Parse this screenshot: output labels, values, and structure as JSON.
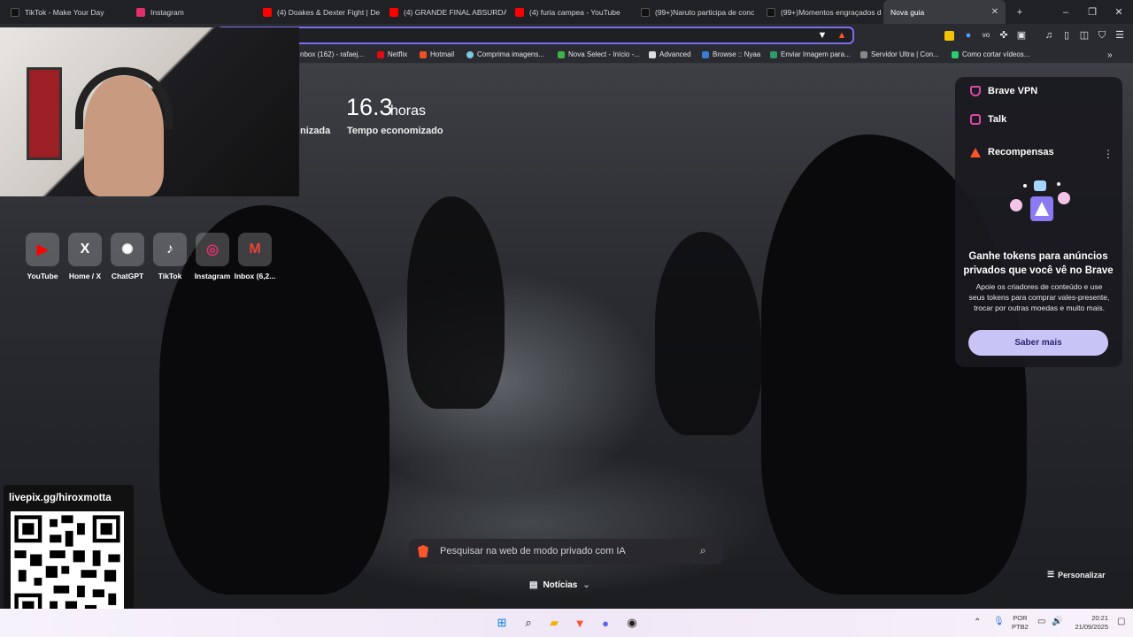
{
  "tabs": [
    {
      "label": "TikTok - Make Your Day",
      "color": "#111111",
      "active": false
    },
    {
      "label": "Instagram",
      "color": "#e1306c",
      "active": false
    },
    {
      "label": "(4) Doakes & Dexter Fight | De",
      "color": "#ff0000",
      "active": false
    },
    {
      "label": "(4) GRANDE FINAL ABSURDA!!",
      "color": "#ff0000",
      "active": false
    },
    {
      "label": "(4) furia campea - YouTube",
      "color": "#ff0000",
      "active": false
    },
    {
      "label": "(99+)Naruto participa de conc",
      "color": "#111111",
      "active": false
    },
    {
      "label": "(99+)Momentos engraçados d",
      "color": "#111111",
      "active": false
    },
    {
      "label": "Nova guia",
      "color": "",
      "active": true
    }
  ],
  "window": {
    "new_tab": "+",
    "minimize": "–",
    "restore": "❐",
    "close": "✕"
  },
  "bookmarks": [
    {
      "label": "nbox (162) - rafaej...",
      "color": "#ffffff"
    },
    {
      "label": "Netflix",
      "color": "#e50914"
    },
    {
      "label": "Hotmail",
      "color": "#f25022"
    },
    {
      "label": "Comprima imagens...",
      "color": "#7ec8e3"
    },
    {
      "label": "Nova Select - Início -...",
      "color": "#3bb54a"
    },
    {
      "label": "Advanced",
      "color": "#dddddd"
    },
    {
      "label": "Browse :: Nyaa",
      "color": "#3a7bd5"
    },
    {
      "label": "Enviar Imagem para...",
      "color": "#2e9c6a"
    },
    {
      "label": "Servidor Ultra | Con...",
      "color": "#888888"
    },
    {
      "label": "Como cortar vídeos...",
      "color": "#2ecc71"
    }
  ],
  "stats": {
    "number": "16.3",
    "unit": "horas",
    "label": "Tempo economizado",
    "partial_label": "nizada"
  },
  "top_sites": [
    {
      "label": "YouTube",
      "glyph": "▶",
      "color": "#ff0000"
    },
    {
      "label": "Home / X",
      "glyph": "X",
      "color": "#ffffff"
    },
    {
      "label": "ChatGPT",
      "glyph": "✺",
      "color": "#ffffff"
    },
    {
      "label": "TikTok",
      "glyph": "♪",
      "color": "#ffffff"
    },
    {
      "label": "Instagram",
      "glyph": "◎",
      "color": "#e1306c"
    },
    {
      "label": "Inbox (6,2...",
      "glyph": "M",
      "color": "#ea4335"
    }
  ],
  "panel": {
    "vpn": "Brave VPN",
    "talk": "Talk",
    "rewards": "Recompensas",
    "menu_icon": "⋮",
    "title": "Ganhe tokens para anúncios privados que você vê no Brave",
    "description": "Apoie os criadores de conteúdo e use seus tokens para comprar vales-presente, trocar por outras moedas e muito mais.",
    "button": "Saber mais"
  },
  "search": {
    "placeholder": "Pesquisar na web de modo privado com IA"
  },
  "news": {
    "label": "Notícias"
  },
  "customize": {
    "label": "Personalizar"
  },
  "overlay": {
    "livepix": "livepix.gg/hiroxmotta"
  },
  "taskbar": {
    "lang1": "POR",
    "lang2": "PTB2",
    "time": "20:21",
    "date": "21/09/2025"
  },
  "colors": {
    "accent": "#7b6ff0",
    "brave": "#fb542b",
    "button_bg": "#c9c4f6"
  }
}
